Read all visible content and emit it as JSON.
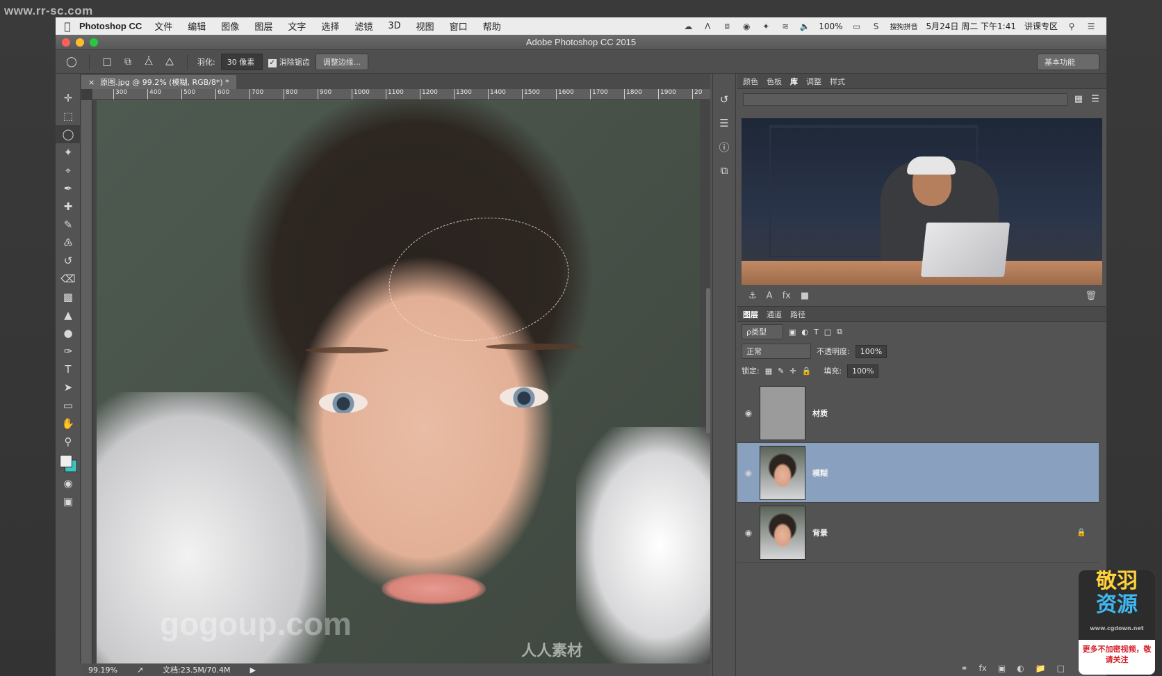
{
  "site_tag": "www.rr-sc.com",
  "menubar": {
    "app": "Photoshop CC",
    "items": [
      "文件",
      "编辑",
      "图像",
      "图层",
      "文字",
      "选择",
      "滤镜",
      "3D",
      "视图",
      "窗口",
      "帮助"
    ],
    "battery": "100%",
    "ime": "搜狗拼音",
    "datetime": "5月24日 周二 下午1:41",
    "profile": "讲课专区"
  },
  "window": {
    "title": "Adobe Photoshop CC 2015"
  },
  "options": {
    "feather_label": "羽化:",
    "feather_value": "30 像素",
    "antialias_label": "消除锯齿",
    "refine_button": "调整边缘...",
    "workspace": "基本功能"
  },
  "document": {
    "tab_title": "原图.jpg @ 99.2% (模糊, RGB/8*) *",
    "ruler_ticks": [
      "300",
      "400",
      "500",
      "600",
      "700",
      "800",
      "900",
      "1000",
      "1100",
      "1200",
      "1300",
      "1400",
      "1500",
      "1600",
      "1700",
      "1800",
      "1900",
      "20"
    ],
    "zoom": "99.19%",
    "doc_size": "文档:23.5M/70.4M"
  },
  "library_panel": {
    "tabs": [
      "颜色",
      "色板",
      "库",
      "调整",
      "样式"
    ],
    "active_tab": "库"
  },
  "layers_panel": {
    "tabs": [
      "图层",
      "通道",
      "路径"
    ],
    "filter_kind": "ρ类型",
    "blend_mode": "正常",
    "opacity_label": "不透明度:",
    "opacity": "100%",
    "lock_label": "锁定:",
    "fill_label": "填充:",
    "fill": "100%",
    "layers": [
      {
        "name": "材质",
        "selected": false,
        "thumb": "gray"
      },
      {
        "name": "模糊",
        "selected": true,
        "thumb": "face"
      },
      {
        "name": "背景",
        "selected": false,
        "thumb": "face",
        "locked": true
      }
    ]
  },
  "badge": {
    "line1": "敬羽",
    "line2": "资源",
    "url": "www.cgdown.net",
    "note": "更多不加密视频，敬请关注"
  },
  "watermarks": {
    "gogoup": "gogoup.com",
    "rr": "人人素材"
  }
}
